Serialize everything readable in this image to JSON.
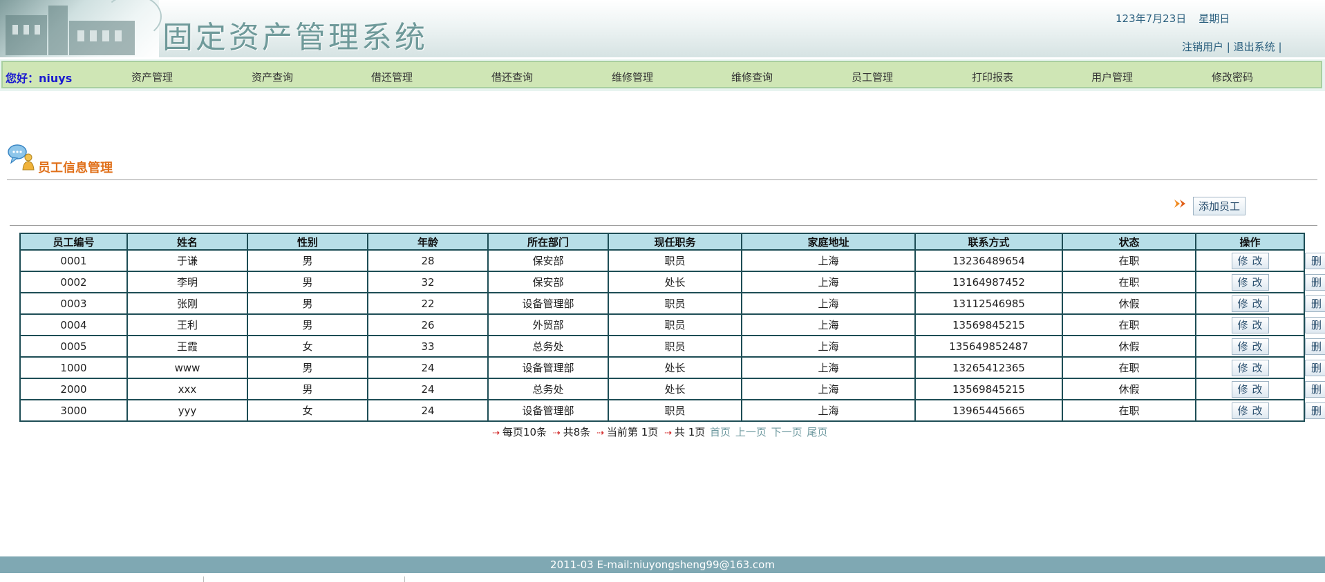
{
  "header": {
    "title": "固定资产管理系统",
    "date": "123年7月23日",
    "weekday": "星期日",
    "logout_user": "注销用户",
    "exit_system": "退出系统",
    "sep": "|"
  },
  "nav": {
    "greeting": "您好：niuys",
    "items": [
      "资产管理",
      "资产查询",
      "借还管理",
      "借还查询",
      "维修管理",
      "维修查询",
      "员工管理",
      "打印报表",
      "用户管理",
      "修改密码"
    ]
  },
  "page": {
    "title": "员工信息管理",
    "add_button": "添加员工"
  },
  "table": {
    "headers": [
      "员工编号",
      "姓名",
      "性别",
      "年龄",
      "所在部门",
      "现任职务",
      "家庭地址",
      "联系方式",
      "状态",
      "操作"
    ],
    "edit_label": "修改",
    "delete_label": "删除",
    "rows": [
      [
        "0001",
        "于谦",
        "男",
        "28",
        "保安部",
        "职员",
        "上海",
        "13236489654",
        "在职"
      ],
      [
        "0002",
        "李明",
        "男",
        "32",
        "保安部",
        "处长",
        "上海",
        "13164987452",
        "在职"
      ],
      [
        "0003",
        "张刚",
        "男",
        "22",
        "设备管理部",
        "职员",
        "上海",
        "13112546985",
        "休假"
      ],
      [
        "0004",
        "王利",
        "男",
        "26",
        "外贸部",
        "职员",
        "上海",
        "13569845215",
        "在职"
      ],
      [
        "0005",
        "王霞",
        "女",
        "33",
        "总务处",
        "职员",
        "上海",
        "135649852487",
        "休假"
      ],
      [
        "1000",
        "www",
        "男",
        "24",
        "设备管理部",
        "处长",
        "上海",
        "13265412365",
        "在职"
      ],
      [
        "2000",
        "xxx",
        "男",
        "24",
        "总务处",
        "处长",
        "上海",
        "13569845215",
        "休假"
      ],
      [
        "3000",
        "yyy",
        "女",
        "24",
        "设备管理部",
        "职员",
        "上海",
        "13965445665",
        "在职"
      ]
    ]
  },
  "pager": {
    "per_page": "每页10条",
    "total": "共8条",
    "current": "当前第 1页",
    "pages": "共 1页",
    "first": "首页",
    "prev": "上一页",
    "next": "下一页",
    "last": "尾页"
  },
  "footer": {
    "text": "2011-03 E-mail:niuyongsheng99@163.com"
  },
  "colors": {
    "nav_bg": "#cfe6b5",
    "table_header": "#b7dfe8",
    "title_orange": "#e0701a",
    "footer_bg": "#7fa8b3",
    "greeting_blue": "#1a1ad0"
  }
}
